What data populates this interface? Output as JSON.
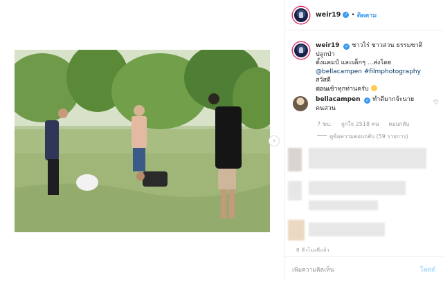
{
  "header": {
    "username": "weir19",
    "separator": "•",
    "follow_label": "ติดตาม"
  },
  "caption": {
    "username": "weir19",
    "text_line1": "ชาวไร่ ชาวสวน ธรรมชาติ ปลูกป่า",
    "text_line2": "ตั้งแคมป์ และเด็กๆ ...ส่งโดย",
    "mention": "@bellacampen",
    "hashtag": "#filmphotography",
    "text_line3_tail": " สวัสดี",
    "text_line4": "ตอนเช้าทุกท่านครับ",
    "time": "8 ชม."
  },
  "comment": {
    "username": "bellacampen",
    "text": "ทำดีมากจ้ะนาย",
    "text_line2": "คนสวน",
    "time": "7 ชม.",
    "likes": "ถูกใจ 2518 คน",
    "reply_label": "ตอบกลับ",
    "view_replies": "ดูข้อความตอบกลับ (59 รายการ)"
  },
  "post_time": "8 ชั่วโมงที่แล้ว",
  "footer": {
    "add_comment_placeholder": "เพิ่มความคิดเห็น",
    "post_label": "โพสต์"
  },
  "icons": {
    "next": "chevron-right-icon",
    "like": "heart-icon",
    "verified": "verified-badge-icon",
    "emoji": "smile-emoji-icon"
  },
  "colors": {
    "link": "#003569",
    "accent": "#3897f0",
    "muted": "#999999",
    "post_disabled": "#b2dffc"
  }
}
